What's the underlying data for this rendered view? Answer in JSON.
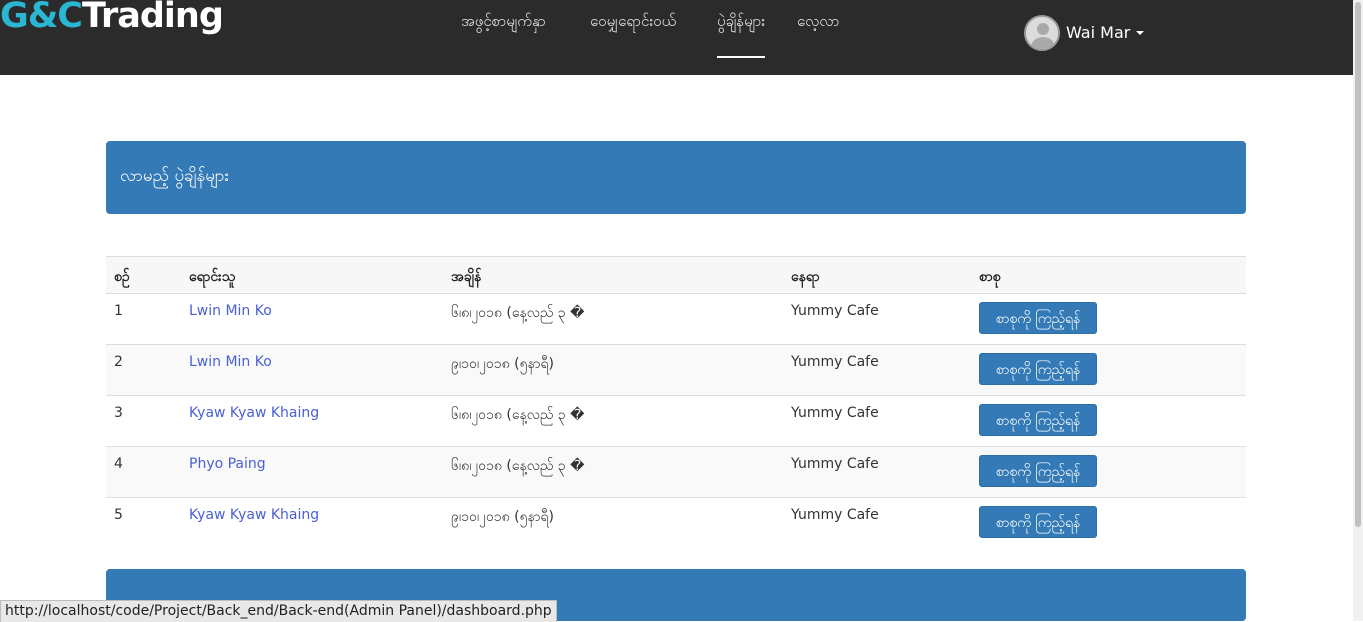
{
  "brand": {
    "part1": "G&C",
    "part2": "Trading"
  },
  "nav": {
    "items": [
      {
        "label": "အဖွင့်စာမျက်နှာ"
      },
      {
        "label": "ဝေမျှရောင်းဝယ်"
      },
      {
        "label": "ပွဲချိန်များ"
      },
      {
        "label": "လေ့လာ"
      }
    ],
    "active_index": 2
  },
  "user": {
    "name": "Wai Mar"
  },
  "panel": {
    "title": "လာမည့် ပွဲချိန်များ"
  },
  "table": {
    "headers": [
      "စဉ်",
      "ရောင်းသူ",
      "အချိန်",
      "နေရာ",
      "စာစု"
    ],
    "rows": [
      {
        "no": "1",
        "seller": "Lwin Min Ko",
        "time": "၆၊၈၊၂၀၁၈ (နေ့လည် ၃ �",
        "place": "Yummy Cafe",
        "action": "စာစုကို ကြည့်ရန်"
      },
      {
        "no": "2",
        "seller": "Lwin Min Ko",
        "time": "၉၊၁၀၊၂၀၁၈ (၅နာရီ)",
        "place": "Yummy Cafe",
        "action": "စာစုကို ကြည့်ရန်"
      },
      {
        "no": "3",
        "seller": "Kyaw Kyaw Khaing",
        "time": "၆၊၈၊၂၀၁၈ (နေ့လည် ၃ �",
        "place": "Yummy Cafe",
        "action": "စာစုကို ကြည့်ရန်"
      },
      {
        "no": "4",
        "seller": "Phyo Paing",
        "time": "၆၊၈၊၂၀၁၈ (နေ့လည် ၃ �",
        "place": "Yummy Cafe",
        "action": "စာစုကို ကြည့်ရန်"
      },
      {
        "no": "5",
        "seller": "Kyaw Kyaw Khaing",
        "time": "၉၊၁၀၊၂၀၁၈ (၅နာရီ)",
        "place": "Yummy Cafe",
        "action": "စာစုကို ကြည့်ရန်"
      }
    ]
  },
  "panel2": {
    "title": ""
  },
  "status_url": "http://localhost/code/Project/Back_end/Back-end(Admin Panel)/dashboard.php",
  "colors": {
    "navbar": "#2b2b2b",
    "brand_accent": "#29b7d3",
    "primary": "#337ab7",
    "link": "#4a5fd6"
  }
}
